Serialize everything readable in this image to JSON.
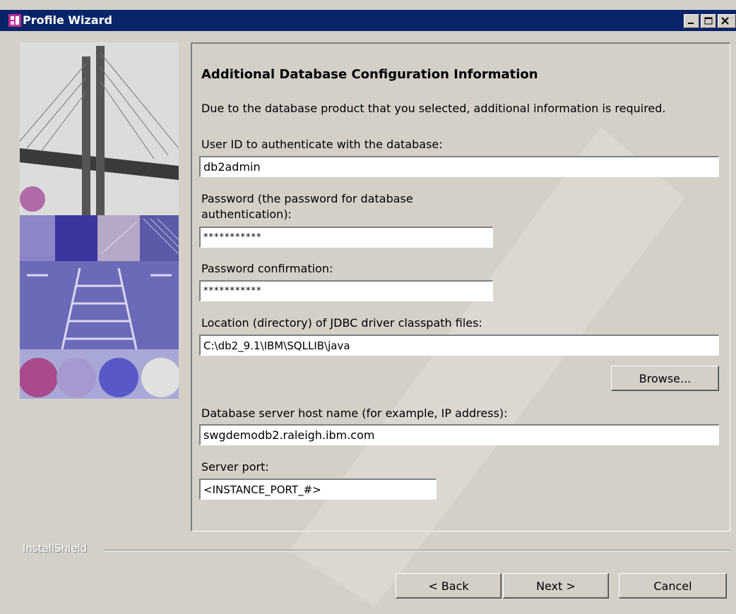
{
  "window": {
    "title": "Profile Wizard"
  },
  "title_buttons": [
    "minimize-icon",
    "maximize-icon",
    "close-icon"
  ],
  "page": {
    "heading": "Additional Database Configuration Information",
    "description": "Due to the database product that you selected, additional information is required."
  },
  "fields": {
    "user_id": {
      "label": "User ID to authenticate with the database:",
      "value": "db2admin"
    },
    "password": {
      "label_line1": "Password (the password for database",
      "label_line2": "authentication):",
      "value": "***********"
    },
    "password_confirm": {
      "label": "Password confirmation:",
      "value": "***********"
    },
    "jdbc_location": {
      "label": "Location (directory) of JDBC driver classpath files:",
      "value": "C:\\db2_9.1\\IBM\\SQLLIB\\java"
    },
    "host": {
      "label": "Database server host name (for example, IP address):",
      "value": "swgdemodb2.raleigh.ibm.com"
    },
    "port": {
      "label": "Server port:",
      "value": "<INSTANCE_PORT_#>"
    }
  },
  "buttons": {
    "browse": "Browse...",
    "back": "< Back",
    "next": "Next >",
    "cancel": "Cancel"
  },
  "footer": {
    "brand": "InstallShield"
  },
  "colors": {
    "titlebar": "#0a246a",
    "face": "#d4d0c8"
  }
}
